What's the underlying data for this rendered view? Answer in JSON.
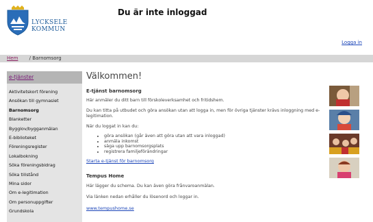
{
  "header": {
    "logo_line1": "LYCKSELE",
    "logo_line2": "KOMMUN",
    "login_status": "Du är inte inloggad",
    "login_link": "Logga in"
  },
  "breadcrumb": {
    "home": "Hem",
    "separator": "/",
    "current": "Barnomsorg"
  },
  "sidebar": {
    "heading": "e-tjänster",
    "items": [
      "Aktivitetskort förening",
      "Ansökan till gymnasiet",
      "Barnomsorg",
      "Blanketter",
      "Bygglov/bygganmälan",
      "E-biblioteket",
      "Föreningsregister",
      "Lokalbokning",
      "Söka föreningsbidrag",
      "Söka tillstånd",
      "Mina sidor",
      "Om e-legitimation",
      "Om personuppgifter",
      "Grundskola"
    ]
  },
  "main": {
    "title": "Välkommen!",
    "section1_heading": "E-tjänst barnomsorg",
    "section1_p1": "Här anmäler du ditt barn till förskoleverksamhet och fritidshem.",
    "section1_p2": "Du kan titta på utbudet och göra ansökan utan att logga in, men för övriga tjänster krävs inloggning med e-legitimation.",
    "section1_p3": "När du loggat in kan du:",
    "list": [
      "göra ansökan (går även att göra utan att vara inloggad)",
      "anmäla inkomst",
      "säga upp barnomsorgsplats",
      "registrera familjeförändringar"
    ],
    "start_link": "Starta e-tjänst för barnomsorg",
    "section2_heading": "Tempus Home",
    "section2_p1": "Här lägger du schema. Du kan även göra frånvaroanmälan.",
    "section2_p2": "Via länken nedan erhåller du lösenord och loggar in.",
    "tempus_link": "www.tempushome.se"
  },
  "colors": {
    "link": "#1a44b8",
    "sidebar_heading_link": "#7a1a78",
    "breadcrumb_bg": "#d6d6d6",
    "sidebar_bg": "#e4e4e4",
    "sidebar_heading_bg": "#b5b5b5",
    "logo_blue": "#1c5a99"
  },
  "icons": {
    "logo": "lycksele-coat-of-arms-icon"
  }
}
